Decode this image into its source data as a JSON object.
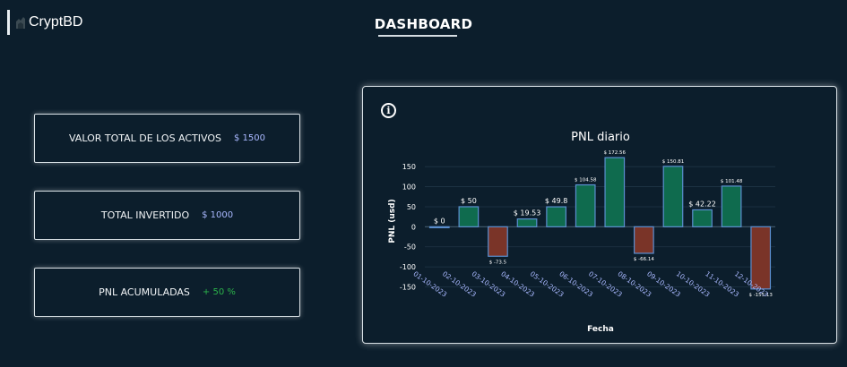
{
  "header": {
    "logo_text": "CryptBD",
    "page_title": "DASHBOARD"
  },
  "cards": [
    {
      "label": "VALOR TOTAL DE LOS ACTIVOS",
      "value": "$ 1500"
    },
    {
      "label": "TOTAL INVERTIDO",
      "value": "$ 1000"
    },
    {
      "label": "PNL ACUMULADAS",
      "value": "+ 50 %"
    }
  ],
  "info_icon": "info-icon",
  "colors": {
    "background": "#0c1e2c",
    "positive_bar": "#0f6b4e",
    "negative_bar": "#7a3428",
    "bar_border": "#5b8fd0",
    "accent_value": "#a9b8ff",
    "green_value": "#2bb34a"
  },
  "chart_data": {
    "type": "bar",
    "title": "PNL diario",
    "xlabel": "Fecha",
    "ylabel": "PNL (usd)",
    "ylim": [
      -160,
      175
    ],
    "yticks": [
      150,
      100,
      50,
      0,
      -50,
      -100,
      -150
    ],
    "grid": true,
    "categories": [
      "01-10-2023",
      "02-10-2023",
      "03-10-2023",
      "04-10-2023",
      "05-10-2023",
      "06-10-2023",
      "07-10-2023",
      "08-10-2023",
      "09-10-2023",
      "10-10-2023",
      "11-10-2023",
      "12-10-2023"
    ],
    "values": [
      0,
      50,
      -73.5,
      19.53,
      49.8,
      104.58,
      172.56,
      -66.14,
      150.81,
      42.22,
      101.48,
      -155.13
    ],
    "labels": [
      "$ 0",
      "$ 50",
      "$ -73.5",
      "$ 19.53",
      "$ 49.8",
      "$ 104.58",
      "$ 172.56",
      "$ -66.14",
      "$ 150.81",
      "$ 42.22",
      "$ 101.48",
      "$ -155.13"
    ]
  }
}
